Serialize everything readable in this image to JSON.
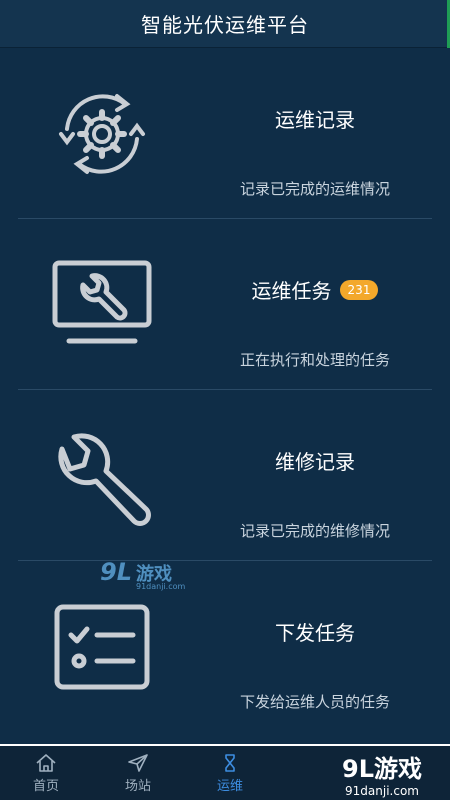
{
  "header": {
    "title": "智能光伏运维平台"
  },
  "cards": [
    {
      "title": "运维记录",
      "description": "记录已完成的运维情况",
      "icon": "gear-refresh-icon"
    },
    {
      "title": "运维任务",
      "badge": "231",
      "description": "正在执行和处理的任务",
      "icon": "monitor-wrench-icon"
    },
    {
      "title": "维修记录",
      "description": "记录已完成的维修情况",
      "icon": "wrench-icon"
    },
    {
      "title": "下发任务",
      "description": "下发给运维人员的任务",
      "icon": "checklist-icon"
    }
  ],
  "watermark": {
    "main": "9L",
    "text": "游戏",
    "sub": "91danji.com"
  },
  "tabbar": {
    "items": [
      {
        "label": "首页",
        "icon": "home-icon",
        "active": false
      },
      {
        "label": "场站",
        "icon": "send-icon",
        "active": false
      },
      {
        "label": "运维",
        "icon": "hourglass-icon",
        "active": true
      }
    ]
  },
  "brand": {
    "main": "9L游戏",
    "sub": "91danji.com"
  },
  "colors": {
    "background": "#0f2d47",
    "accent": "#3d8de0",
    "badge": "#f3a82b"
  }
}
